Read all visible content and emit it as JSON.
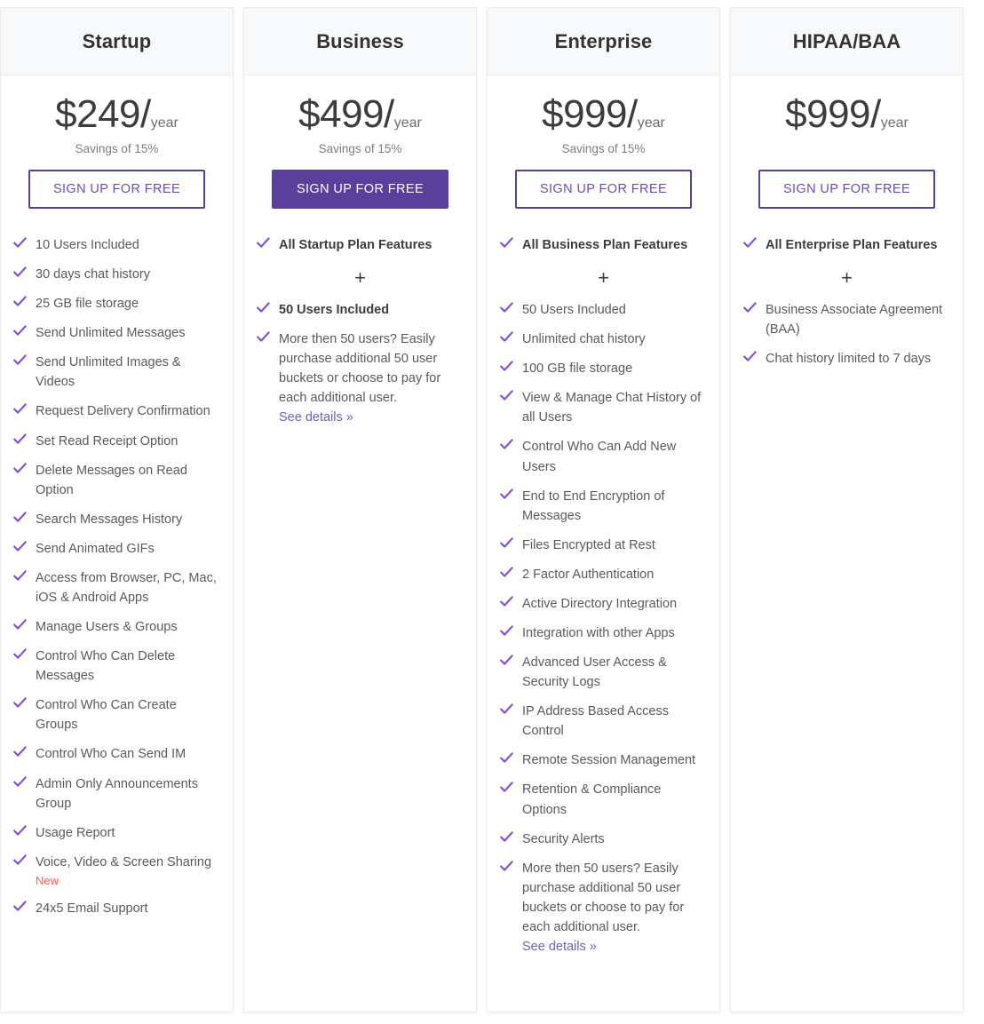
{
  "accent": {
    "purple": "#5b3f9d",
    "purple_light": "#7460bb",
    "check": "#7c4dd6",
    "new_badge": "#f4605c",
    "header_bg": "#f7f8f9"
  },
  "icons": {
    "check": "check-icon",
    "plus": "plus-icon"
  },
  "plans": [
    {
      "name": "Startup",
      "price_amount": "$249/",
      "price_period": "year",
      "savings": "Savings of 15%",
      "cta_label": "SIGN UP FOR FREE",
      "cta_style": "outline",
      "has_plus_divider": false,
      "plus_symbol": "",
      "features": [
        {
          "text": "10 Users Included",
          "bold": false
        },
        {
          "text": "30 days chat history",
          "bold": false
        },
        {
          "text": "25 GB file storage",
          "bold": false
        },
        {
          "text": "Send Unlimited Messages",
          "bold": false
        },
        {
          "text": "Send Unlimited Images & Videos",
          "bold": false
        },
        {
          "text": "Request Delivery Confirmation",
          "bold": false
        },
        {
          "text": "Set Read Receipt Option",
          "bold": false
        },
        {
          "text": "Delete Messages on Read Option",
          "bold": false
        },
        {
          "text": "Search Messages History",
          "bold": false
        },
        {
          "text": "Send Animated GIFs",
          "bold": false
        },
        {
          "text": "Access from Browser, PC, Mac, iOS & Android Apps",
          "bold": false
        },
        {
          "text": "Manage Users & Groups",
          "bold": false
        },
        {
          "text": "Control Who Can Delete Messages",
          "bold": false
        },
        {
          "text": "Control Who Can Create Groups",
          "bold": false
        },
        {
          "text": "Control Who Can Send IM",
          "bold": false
        },
        {
          "text": "Admin Only Announcements Group",
          "bold": false
        },
        {
          "text": "Usage Report",
          "bold": false
        },
        {
          "text": "Voice, Video & Screen Sharing",
          "bold": false,
          "badge": "New"
        },
        {
          "text": "24x5 Email Support",
          "bold": false
        }
      ]
    },
    {
      "name": "Business",
      "price_amount": "$499/",
      "price_period": "year",
      "savings": "Savings of 15%",
      "cta_label": "SIGN UP FOR FREE",
      "cta_style": "filled",
      "has_plus_divider": true,
      "plus_symbol": "+",
      "features_before_plus": [
        {
          "text": "All Startup Plan Features",
          "bold": true
        }
      ],
      "features": [
        {
          "text": "50 Users Included",
          "bold": true
        },
        {
          "text": "More then 50 users? Easily purchase additional 50 user buckets or choose to pay for each additional user.",
          "bold": false,
          "link": "See details »"
        }
      ]
    },
    {
      "name": "Enterprise",
      "price_amount": "$999/",
      "price_period": "year",
      "savings": "Savings of 15%",
      "cta_label": "SIGN UP FOR FREE",
      "cta_style": "outline",
      "has_plus_divider": true,
      "plus_symbol": "+",
      "features_before_plus": [
        {
          "text": "All Business Plan Features",
          "bold": true
        }
      ],
      "features": [
        {
          "text": "50 Users Included",
          "bold": false
        },
        {
          "text": "Unlimited chat history",
          "bold": false
        },
        {
          "text": "100 GB file storage",
          "bold": false
        },
        {
          "text": "View & Manage Chat History of all Users",
          "bold": false
        },
        {
          "text": "Control Who Can Add New Users",
          "bold": false
        },
        {
          "text": "End to End Encryption of Messages",
          "bold": false
        },
        {
          "text": "Files Encrypted at Rest",
          "bold": false
        },
        {
          "text": "2 Factor Authentication",
          "bold": false
        },
        {
          "text": "Active Directory Integration",
          "bold": false
        },
        {
          "text": "Integration with other Apps",
          "bold": false
        },
        {
          "text": "Advanced User Access & Security Logs",
          "bold": false
        },
        {
          "text": "IP Address Based Access Control",
          "bold": false
        },
        {
          "text": "Remote Session Management",
          "bold": false
        },
        {
          "text": "Retention & Compliance Options",
          "bold": false
        },
        {
          "text": "Security Alerts",
          "bold": false
        },
        {
          "text": "More then 50 users? Easily purchase additional 50 user buckets or choose to pay for each additional user.",
          "bold": false,
          "link": "See details »"
        }
      ]
    },
    {
      "name": "HIPAA/BAA",
      "price_amount": "$999/",
      "price_period": "year",
      "savings": "",
      "cta_label": "SIGN UP FOR FREE",
      "cta_style": "outline",
      "has_plus_divider": true,
      "plus_symbol": "+",
      "features_before_plus": [
        {
          "text": "All Enterprise Plan Features",
          "bold": true
        }
      ],
      "features": [
        {
          "text": "Business Associate Agreement (BAA)",
          "bold": false
        },
        {
          "text": "Chat history limited to 7 days",
          "bold": false
        }
      ]
    }
  ]
}
